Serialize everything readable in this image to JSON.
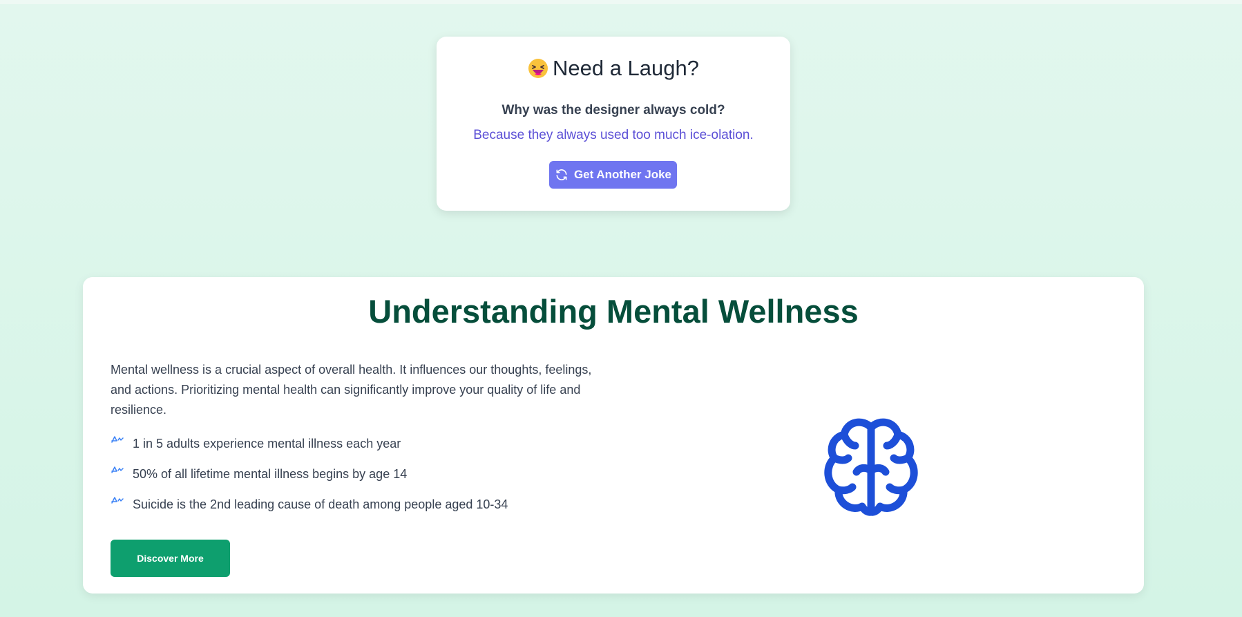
{
  "joke": {
    "title": "Need a Laugh?",
    "emoji_icon": "laughing-face-icon",
    "question": "Why was the designer always cold?",
    "answer": "Because they always used too much ice-olation.",
    "button_label": "Get Another Joke",
    "button_icon": "refresh-icon",
    "button_color": "#6f75f0",
    "answer_color": "#5b4fd6"
  },
  "wellness": {
    "title": "Understanding Mental Wellness",
    "description": "Mental wellness is a crucial aspect of overall health. It influences our thoughts, feelings, and actions. Prioritizing mental health can significantly improve your quality of life and resilience.",
    "stats": [
      {
        "icon": "chart-line-icon",
        "text": "1 in 5 adults experience mental illness each year"
      },
      {
        "icon": "chart-line-icon",
        "text": "50% of all lifetime mental illness begins by age 14"
      },
      {
        "icon": "chart-line-icon",
        "text": "Suicide is the 2nd leading cause of death among people aged 10-34"
      }
    ],
    "button_label": "Discover More",
    "button_color": "#0e9f6e",
    "title_color": "#064e3b",
    "illustration_icon": "brain-icon",
    "illustration_color": "#1d4fd8"
  }
}
